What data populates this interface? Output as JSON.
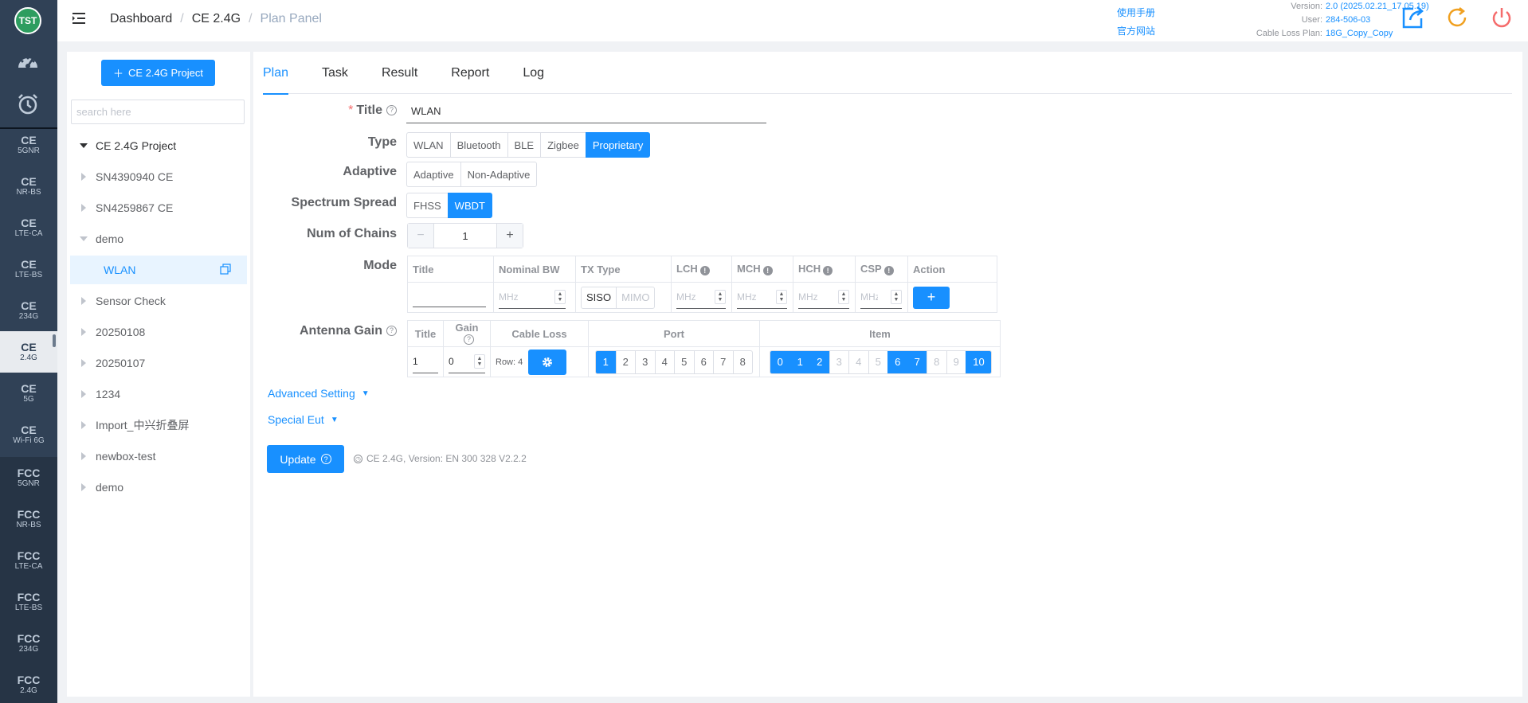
{
  "leftnav": {
    "logo": "TST",
    "items": [
      {
        "top": "CE",
        "sub": "5GNR"
      },
      {
        "top": "CE",
        "sub": "NR-BS"
      },
      {
        "top": "CE",
        "sub": "LTE-CA"
      },
      {
        "top": "CE",
        "sub": "LTE-BS"
      },
      {
        "top": "CE",
        "sub": "234G"
      },
      {
        "top": "CE",
        "sub": "2.4G"
      },
      {
        "top": "CE",
        "sub": "5G"
      },
      {
        "top": "CE",
        "sub": "Wi-Fi 6G"
      },
      {
        "top": "FCC",
        "sub": "5GNR"
      },
      {
        "top": "FCC",
        "sub": "NR-BS"
      },
      {
        "top": "FCC",
        "sub": "LTE-CA"
      },
      {
        "top": "FCC",
        "sub": "LTE-BS"
      },
      {
        "top": "FCC",
        "sub": "234G"
      },
      {
        "top": "FCC",
        "sub": "2.4G"
      }
    ],
    "active_index": 5
  },
  "header": {
    "breadcrumb": [
      "Dashboard",
      "CE 2.4G",
      "Plan Panel"
    ],
    "help_links": [
      "使用手册",
      "官方网站"
    ],
    "version_label": "Version:",
    "version": "2.0 (2025.02.21_17.05.19)",
    "user_label": "User:",
    "user": "284-506-03",
    "cable_label": "Cable Loss Plan:",
    "cable": "18G_Copy_Copy"
  },
  "sidebar": {
    "add_button": "CE 2.4G Project",
    "search_placeholder": "search here",
    "tree": [
      {
        "label": "CE 2.4G Project",
        "level": 0,
        "expanded": true
      },
      {
        "label": "SN4390940 CE",
        "level": 1
      },
      {
        "label": "SN4259867 CE",
        "level": 1
      },
      {
        "label": "demo",
        "level": 1,
        "expanded": true
      },
      {
        "label": "WLAN",
        "level": 2,
        "selected": true
      },
      {
        "label": "Sensor Check",
        "level": 1
      },
      {
        "label": "20250108",
        "level": 1
      },
      {
        "label": "20250107",
        "level": 1
      },
      {
        "label": "1234",
        "level": 1
      },
      {
        "label": "Import_中兴折叠屏",
        "level": 1
      },
      {
        "label": "newbox-test",
        "level": 1
      },
      {
        "label": "demo",
        "level": 1
      }
    ]
  },
  "tabs": [
    "Plan",
    "Task",
    "Result",
    "Report",
    "Log"
  ],
  "form": {
    "title_label": "Title",
    "title_value": "WLAN",
    "type_label": "Type",
    "type_options": [
      "WLAN",
      "Bluetooth",
      "BLE",
      "Zigbee",
      "Proprietary"
    ],
    "type_selected": "Proprietary",
    "adaptive_label": "Adaptive",
    "adaptive_options": [
      "Adaptive",
      "Non-Adaptive"
    ],
    "spread_label": "Spectrum Spread",
    "spread_options": [
      "FHSS",
      "WBDT"
    ],
    "spread_selected": "WBDT",
    "chains_label": "Num of Chains",
    "chains_value": "1",
    "chains_minus": "−",
    "chains_plus": "+",
    "mode_label": "Mode",
    "mode_headers": [
      "Title",
      "Nominal BW",
      "TX Type",
      "LCH",
      "MCH",
      "HCH",
      "CSP",
      "Action"
    ],
    "mhz_placeholder": "MHz",
    "tx_siso": "SISO",
    "tx_mimo": "MIMO",
    "add_btn": "+",
    "ag_label": "Antenna Gain",
    "ag_headers": [
      "Title",
      "Gain",
      "Cable Loss",
      "Port",
      "Item"
    ],
    "ag_title_value": "1",
    "ag_gain_value": "0",
    "row_label": "Row: 4",
    "ports": [
      "1",
      "2",
      "3",
      "4",
      "5",
      "6",
      "7",
      "8"
    ],
    "ports_selected": [
      "1"
    ],
    "items": [
      "0",
      "1",
      "2",
      "3",
      "4",
      "5",
      "6",
      "7",
      "8",
      "9",
      "10"
    ],
    "items_selected": [
      "0",
      "1",
      "2",
      "6",
      "7",
      "10"
    ],
    "items_disabled": [
      "3",
      "4",
      "5",
      "8",
      "9"
    ],
    "advanced": "Advanced Setting",
    "special": "Special Eut",
    "update": "Update",
    "standard_note": "CE 2.4G, Version: EN 300 328 V2.2.2"
  },
  "colors": {
    "primary": "#1890ff",
    "nav_bg": "#304156",
    "danger": "#f56c6c",
    "warning": "#f0a020"
  }
}
